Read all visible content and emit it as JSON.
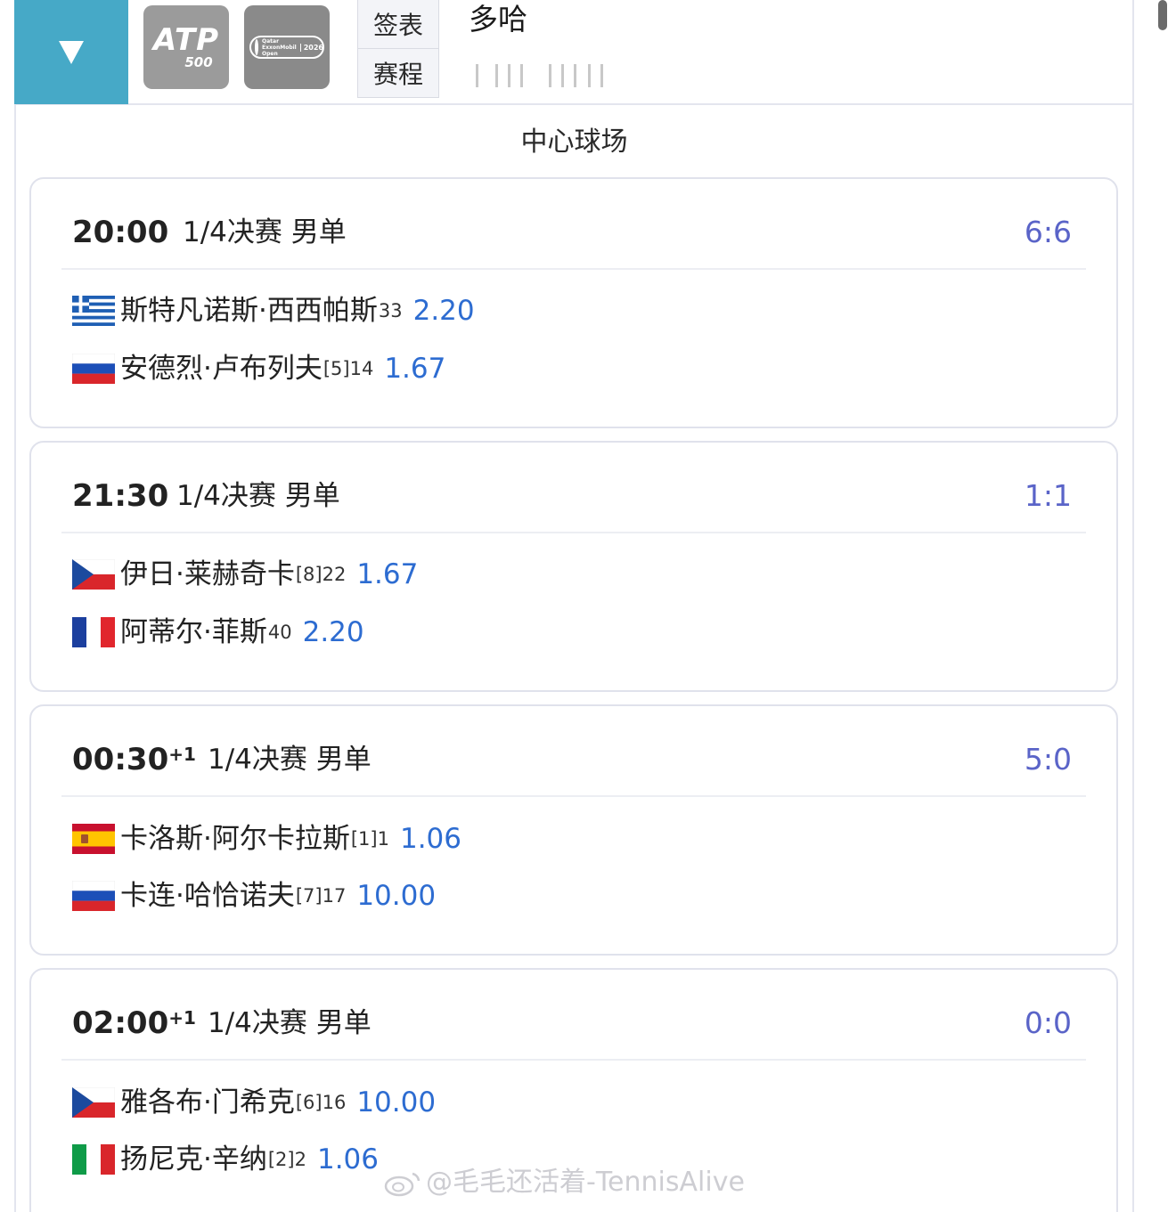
{
  "header": {
    "logos": {
      "atp_main": "ATP",
      "atp_sub": "500",
      "qatar_text": "Qatar ExxonMobil Open",
      "qatar_year": "2026"
    },
    "tabs": [
      {
        "label": "签表"
      },
      {
        "label": "赛程"
      }
    ],
    "city": "多哈"
  },
  "court": "中心球场",
  "matches": [
    {
      "time": "20:00",
      "day_offset": "",
      "round": "1/4决赛 男单",
      "score": "6:6",
      "players": [
        {
          "flag": "greece-flag-icon",
          "name": "斯特凡诺斯·西西帕斯",
          "seed": "33",
          "odds": "2.20"
        },
        {
          "flag": "russia-flag-icon",
          "name": "安德烈·卢布列夫",
          "seed": "[5]14",
          "odds": "1.67"
        }
      ]
    },
    {
      "time": "21:30",
      "day_offset": "",
      "round": "1/4决赛 男单",
      "score": "1:1",
      "players": [
        {
          "flag": "czech-flag-icon",
          "name": "伊日·莱赫奇卡",
          "seed": "[8]22",
          "odds": "1.67"
        },
        {
          "flag": "france-flag-icon",
          "name": "阿蒂尔·菲斯",
          "seed": "40",
          "odds": "2.20"
        }
      ]
    },
    {
      "time": "00:30",
      "day_offset": "+1",
      "round": "1/4决赛 男单",
      "score": "5:0",
      "players": [
        {
          "flag": "spain-flag-icon",
          "name": "卡洛斯·阿尔卡拉斯",
          "seed": "[1]1",
          "odds": "1.06"
        },
        {
          "flag": "russia-flag-icon",
          "name": "卡连·哈恰诺夫",
          "seed": "[7]17",
          "odds": "10.00"
        }
      ]
    },
    {
      "time": "02:00",
      "day_offset": "+1",
      "round": "1/4决赛 男单",
      "score": "0:0",
      "players": [
        {
          "flag": "czech-flag-icon",
          "name": "雅各布·门希克",
          "seed": "[6]16",
          "odds": "10.00"
        },
        {
          "flag": "italy-flag-icon",
          "name": "扬尼克·辛纳",
          "seed": "[2]2",
          "odds": "1.06"
        }
      ]
    }
  ],
  "watermark": "@毛毛还活着-TennisAlive",
  "colors": {
    "accent": "#46a9c7",
    "score": "#5a64c8",
    "odds": "#2d6cd1",
    "border": "#e0e2ec"
  }
}
